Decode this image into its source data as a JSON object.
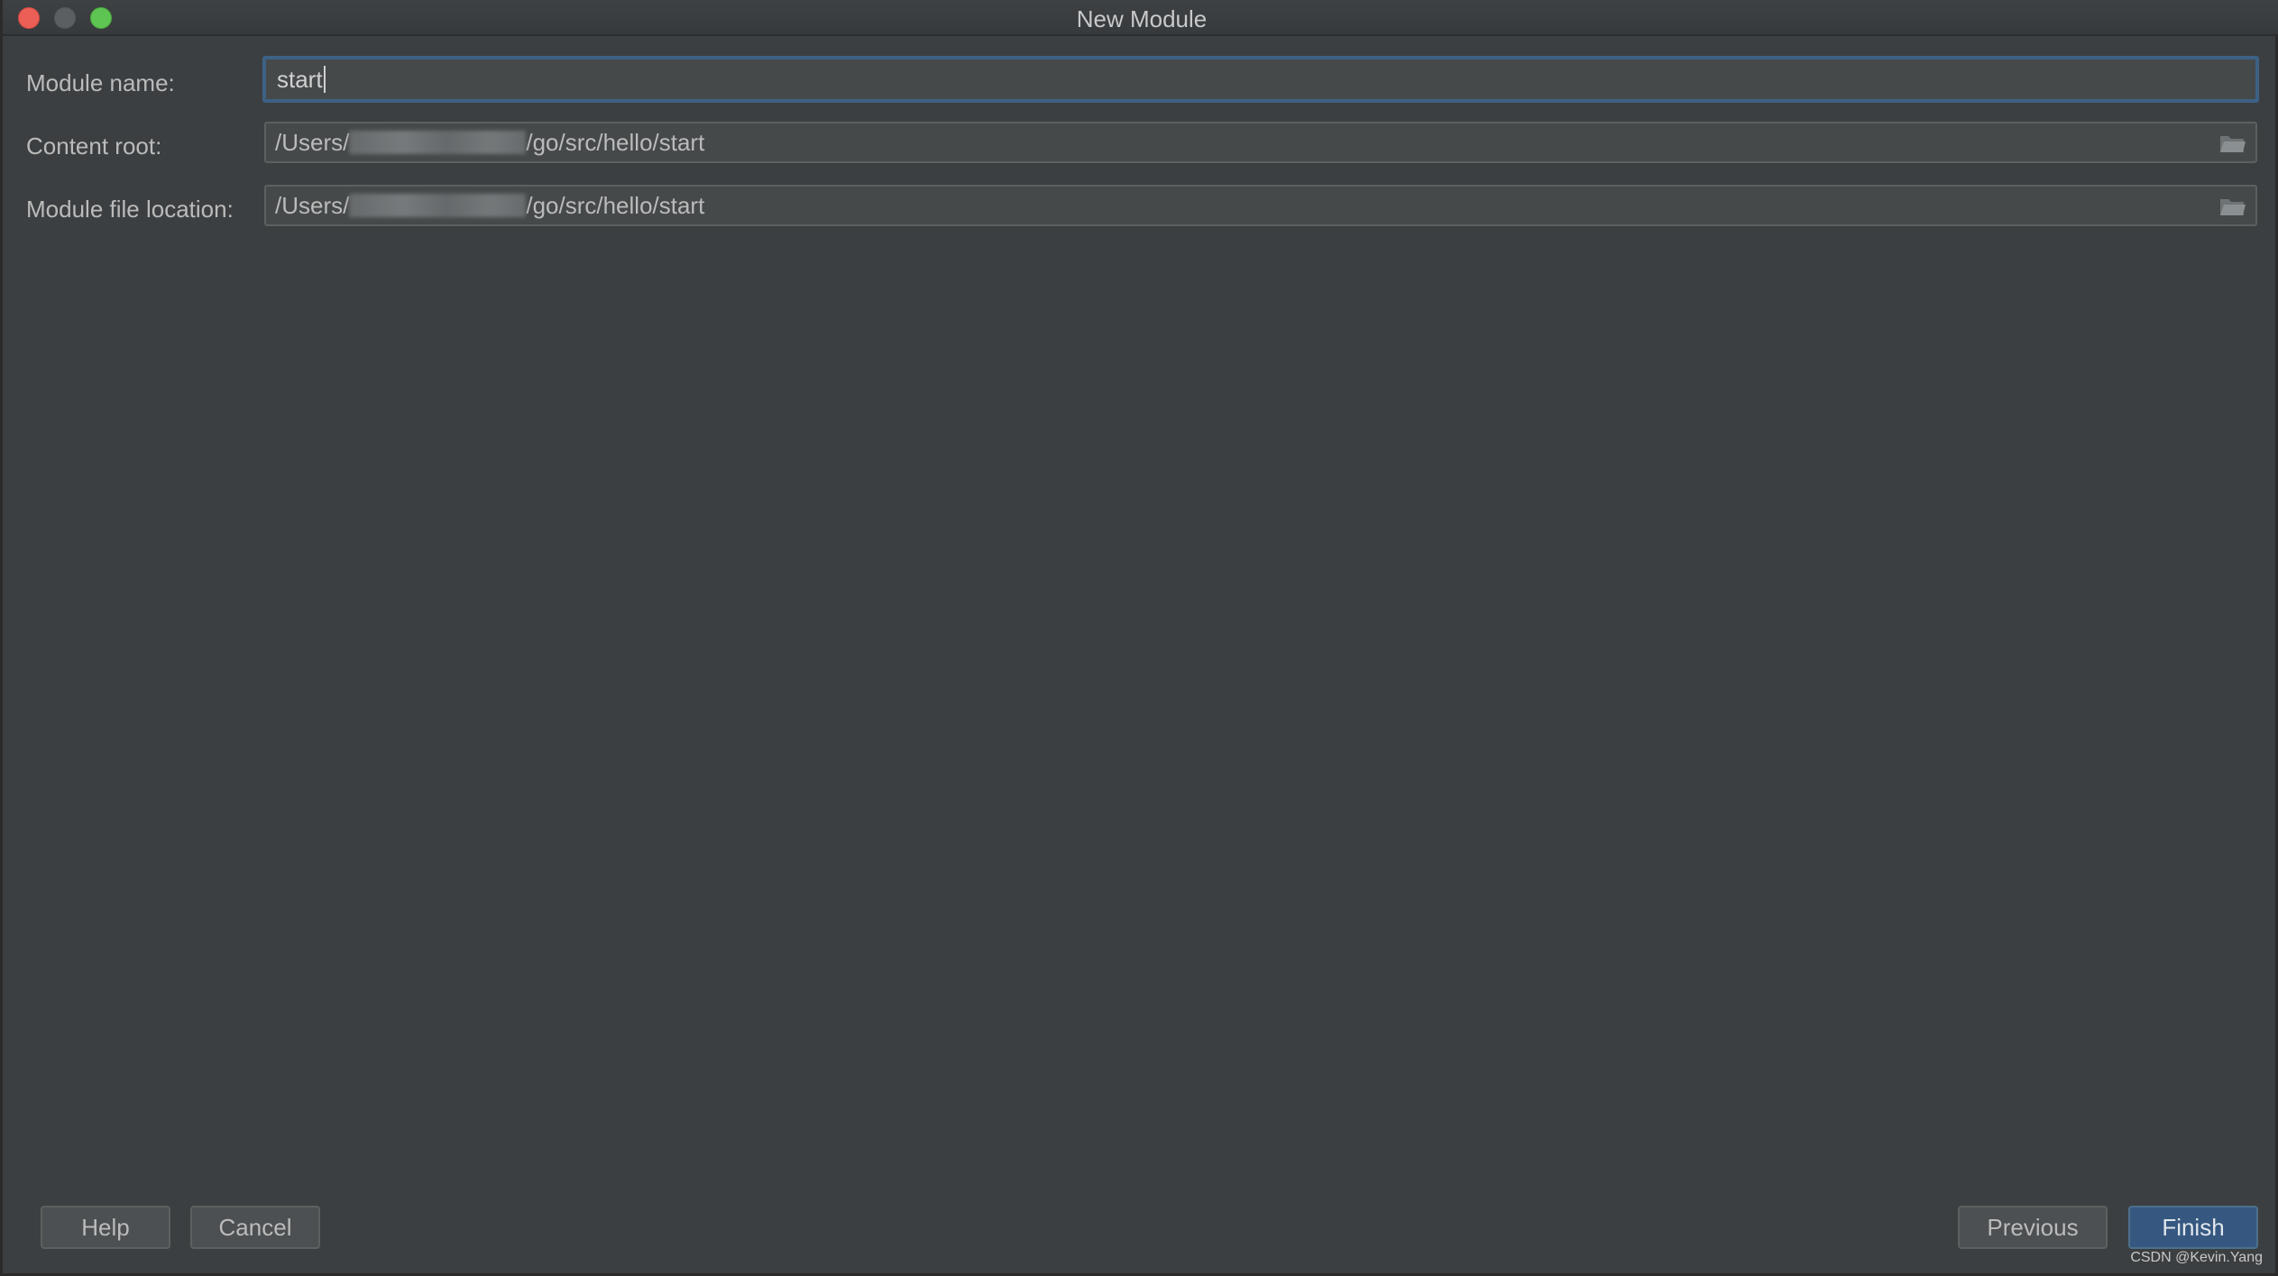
{
  "window": {
    "title": "New Module"
  },
  "form": {
    "module_name": {
      "label": "Module name:",
      "value": "start"
    },
    "content_root": {
      "label": "Content root:",
      "prefix": "/Users/",
      "suffix": "/go/src/hello/start",
      "icon": "folder-icon"
    },
    "module_file_location": {
      "label": "Module file location:",
      "prefix": "/Users/",
      "suffix": "/go/src/hello/start",
      "icon": "folder-icon"
    }
  },
  "buttons": {
    "help": "Help",
    "cancel": "Cancel",
    "previous": "Previous",
    "finish": "Finish"
  },
  "watermark": "CSDN @Kevin.Yang",
  "colors": {
    "background": "#3c3f41",
    "field_background": "#45494a",
    "focus_border": "#3d6185",
    "primary_button": "#365880",
    "close": "#ec5f57",
    "minimize": "#5c5f61",
    "maximize": "#5fc552"
  }
}
